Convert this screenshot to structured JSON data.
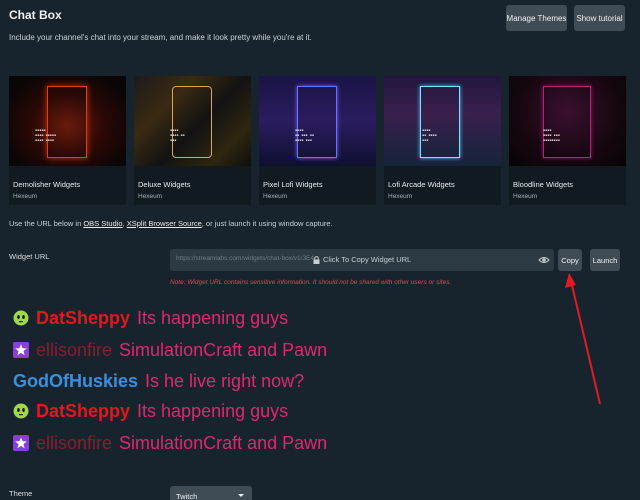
{
  "header": {
    "title": "Chat Box",
    "subtitle": "Include your channel's chat into your stream, and make it look pretty while you're at it.",
    "manage_themes": "Manage Themes",
    "show_tutorial": "Show tutorial"
  },
  "cards": [
    {
      "name": "Demolisher Widgets",
      "author": "Hexeum"
    },
    {
      "name": "Deluxe Widgets",
      "author": "Hexeum"
    },
    {
      "name": "Pixel Lofi Widgets",
      "author": "Hexeum"
    },
    {
      "name": "Lofi Arcade Widgets",
      "author": "Hexeum"
    },
    {
      "name": "Bloodline Widgets",
      "author": "Hexeum"
    }
  ],
  "instructions": {
    "prefix": "Use the URL below in ",
    "link1": "OBS Studio",
    "sep": ", ",
    "link2": "XSplit Browser Source",
    "suffix": ", or just launch it using window capture."
  },
  "widget_url": {
    "label": "Widget URL",
    "url": "https://streamlabs.com/widgets/chat-box/v1/3E4",
    "copy_hint": "Click To Copy Widget URL",
    "copy_button": "Copy",
    "launch_button": "Launch",
    "note": "Note: Widget URL contains sensitive information. It should not be shared with other users or sites."
  },
  "chat": [
    {
      "user": "DatSheppy",
      "text": "Its happening guys",
      "badge": "green-face-icon"
    },
    {
      "user": "ellisonfire",
      "text": "SimulationCraft and Pawn",
      "badge": "purple-star-icon"
    },
    {
      "user": "GodOfHuskies",
      "text": "Is he live right now?",
      "badge": ""
    },
    {
      "user": "DatSheppy",
      "text": "Its happening guys",
      "badge": "green-face-icon"
    },
    {
      "user": "ellisonfire",
      "text": "SimulationCraft and Pawn",
      "badge": "purple-star-icon"
    }
  ],
  "theme": {
    "label": "Theme",
    "selected": "Twitch"
  },
  "colors": {
    "background": "#17242d",
    "button": "#3f4c56",
    "note_red": "#e2464b",
    "user_red": "#e3181c",
    "user_darkred": "#8a1c2c",
    "user_blue": "#3a8fe0",
    "message_pink": "#e0266f",
    "arrow": "#e11b22"
  }
}
